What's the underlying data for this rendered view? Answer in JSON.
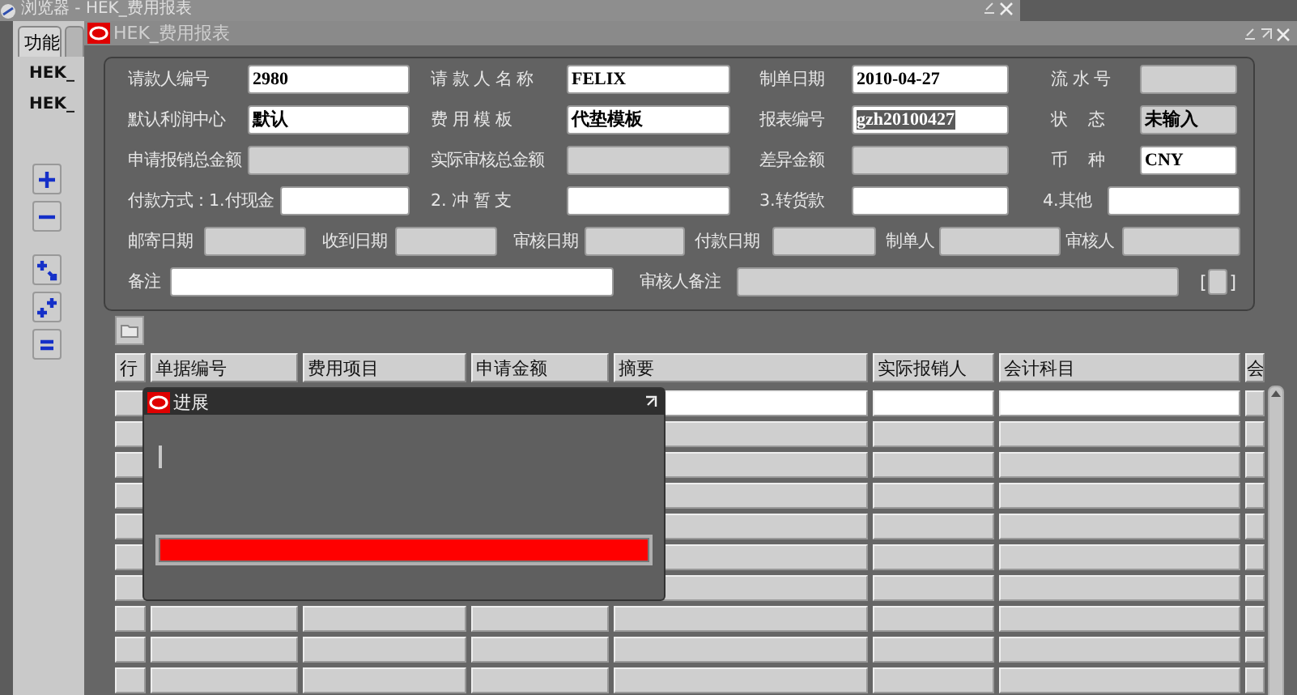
{
  "outer_window": {
    "title": "浏览器 - HEK_费用报表"
  },
  "sidebar": {
    "tabs": [
      {
        "label": "功能",
        "selected": true
      },
      {
        "selected": false
      }
    ],
    "items": [
      "HEK_",
      "HEK_"
    ]
  },
  "window": {
    "title": "HEK_费用报表"
  },
  "form": {
    "rows": [
      [
        {
          "label": "请款人编号",
          "value": "2980",
          "disabled": false
        },
        {
          "label": "请 款 人 名 称",
          "value": "FELIX",
          "disabled": false
        },
        {
          "label": "制单日期",
          "value": "2010-04-27",
          "disabled": false
        },
        {
          "label": "流 水 号",
          "disabled": true
        }
      ],
      [
        {
          "label": "默认利润中心",
          "value": "默认",
          "disabled": false
        },
        {
          "label": "费 用 模 板",
          "value": "代垫模板",
          "disabled": false
        },
        {
          "label": "报表编号",
          "value": "gzh20100427",
          "disabled": false,
          "highlighted": true
        },
        {
          "label": "状    态",
          "value": "未输入",
          "disabled": true
        }
      ],
      [
        {
          "label": "申请报销总金额",
          "disabled": true
        },
        {
          "label": "实际审核总金额",
          "disabled": true
        },
        {
          "label": "差异金额",
          "disabled": true
        },
        {
          "label": "币    种",
          "value": "CNY",
          "disabled": false
        }
      ],
      [
        {
          "label": "付款方式：1.付现金",
          "disabled": false
        },
        {
          "label": "2. 冲 暂 支",
          "disabled": false
        },
        {
          "label": "3.转货款",
          "disabled": false
        },
        {
          "label": "4.其他",
          "disabled": false
        }
      ],
      [
        {
          "label": "邮寄日期",
          "disabled": true
        },
        {
          "label": "收到日期",
          "disabled": true
        },
        {
          "label": "审核日期",
          "disabled": true
        },
        {
          "label": "付款日期",
          "disabled": true
        },
        {
          "label": "制单人",
          "disabled": true
        },
        {
          "label": "审核人",
          "disabled": true
        }
      ],
      [
        {
          "label": "备注",
          "disabled": false
        },
        {
          "label": "审核人备注",
          "disabled": true
        }
      ]
    ],
    "flag_field": {
      "open": "[",
      "close": "]",
      "disabled": true
    }
  },
  "table": {
    "columns": [
      "行",
      "单据编号",
      "费用项目",
      "申请金额",
      "摘要",
      "实际报销人",
      "会计科目",
      "会"
    ],
    "rows": [
      {
        "current": true
      },
      {
        "current": false
      },
      {
        "current": false
      },
      {
        "current": false
      },
      {
        "current": false
      },
      {
        "current": false
      },
      {
        "current": false
      },
      {
        "current": false
      },
      {
        "current": false
      },
      {
        "current": false
      }
    ]
  },
  "progress_dialog": {
    "title": "进展",
    "level": 1
  }
}
